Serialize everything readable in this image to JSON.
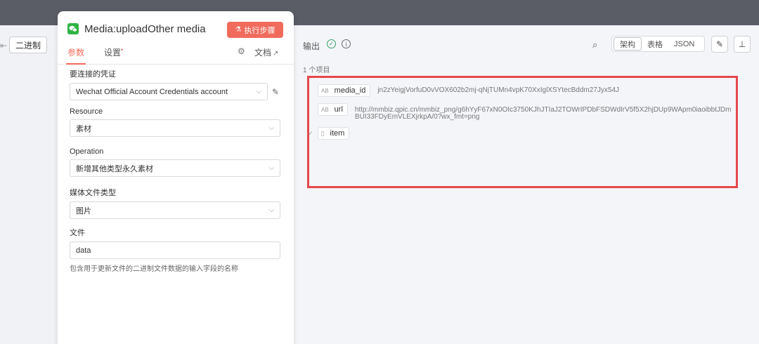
{
  "left_strip": {
    "arrow": "⇤",
    "binary_label": "二进制"
  },
  "node": {
    "title": "Media:uploadOther media",
    "execute_label": "执行步骤",
    "tabs": {
      "params": "参数",
      "settings": "设置",
      "settings_dot": "•",
      "docs": "文档"
    },
    "fields": {
      "credentials_label": "要连接的凭证",
      "credentials_value": "Wechat Official Account Credentials account",
      "resource_label": "Resource",
      "resource_value": "素材",
      "operation_label": "Operation",
      "operation_value": "新增其他类型永久素材",
      "media_type_label": "媒体文件类型",
      "media_type_value": "图片",
      "file_label": "文件",
      "file_value": "data",
      "file_hint": "包含用于更新文件的二进制文件数据的输入字段的名称"
    }
  },
  "output": {
    "label": "输出",
    "items_count": "1 个项目",
    "views": [
      "架构",
      "表格",
      "JSON"
    ],
    "active_view": "架构",
    "rows": {
      "media_id": {
        "type": "AB",
        "key": "media_id",
        "value": "jn2zYeigjVorfuD0vVOX602b2mj-qNjTUMn4vpK70XxIglXSYtecBddm27Jyx54J"
      },
      "url": {
        "type": "AB",
        "key": "url",
        "value": "http://mmbiz.qpic.cn/mmbiz_png/g6hYyF67xN0OIc3750KJhJTIaJ2TOWrIPDbFSDWdIrV5f5X2hjDUp9WApm0iaoibbtJDmBUI33FDyEmVLEXjrkpA/0?wx_fmt=png"
      },
      "item": {
        "type": "▯",
        "key": "item",
        "toggle": "✓"
      }
    }
  },
  "colors": {
    "accent": "#f06b5c",
    "highlight": "#e5484d",
    "success": "#35a26b",
    "topbar": "#5b5d66"
  },
  "icons": {
    "node": "wechat-icon",
    "execute": "flask-icon",
    "gear": "gear-icon",
    "docs_external": "external-link-icon",
    "success": "check-circle-icon",
    "info": "info-icon",
    "search": "search-icon",
    "edit": "pencil-icon",
    "pin": "pin-icon"
  }
}
